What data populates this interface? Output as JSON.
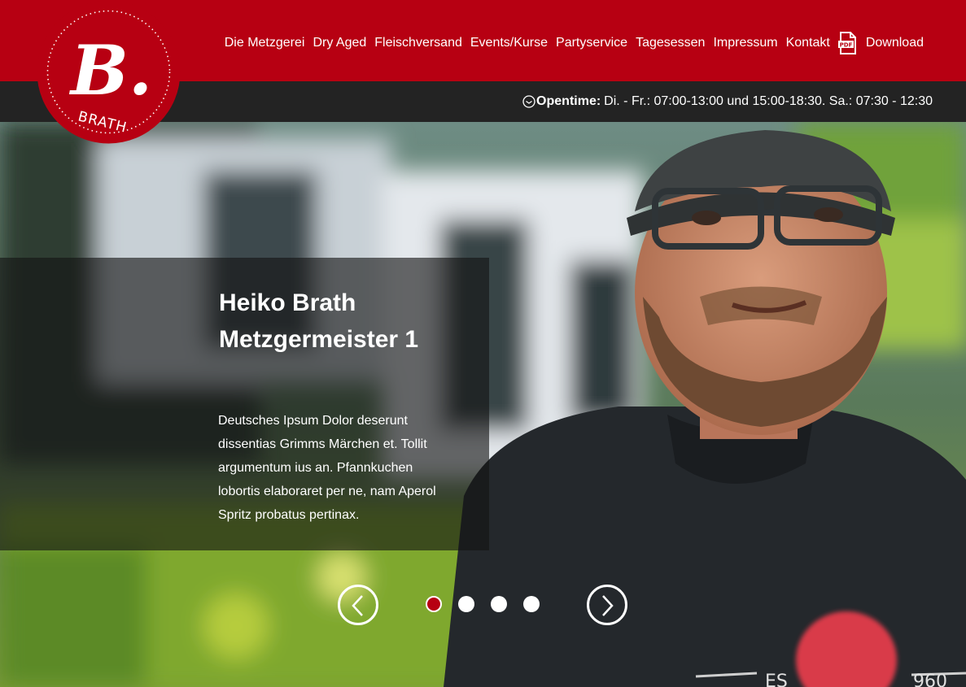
{
  "brand": {
    "logo_letter": "B.",
    "logo_text": "BRATH",
    "colors": {
      "primary": "#b70012",
      "dark": "#232323"
    }
  },
  "nav": {
    "items": [
      {
        "label": "Die Metzgerei"
      },
      {
        "label": "Dry Aged"
      },
      {
        "label": "Fleischversand"
      },
      {
        "label": "Events/Kurse"
      },
      {
        "label": "Partyservice"
      },
      {
        "label": "Tagesessen"
      },
      {
        "label": "Impressum"
      },
      {
        "label": "Kontakt"
      }
    ],
    "download": {
      "label": "Download",
      "icon": "pdf-icon"
    }
  },
  "opentime": {
    "icon": "clock-icon",
    "label": "Opentime:",
    "text": "Di. - Fr.: 07:00-13:00 und 15:00-18:30. Sa.: 07:30 - 12:30"
  },
  "slider": {
    "title_line1": "Heiko Brath",
    "title_line2": "Metzgermeister 1",
    "text": "Deutsches Ipsum Dolor deserunt dissentias Grimms Märchen et. Tollit argumentum ius an. Pfannkuchen lobortis elaboraret per ne, nam Aperol Spritz probatus pertinax.",
    "slide_count": 4,
    "active_slide": 1,
    "prev_icon": "chevron-left-icon",
    "next_icon": "chevron-right-icon"
  }
}
